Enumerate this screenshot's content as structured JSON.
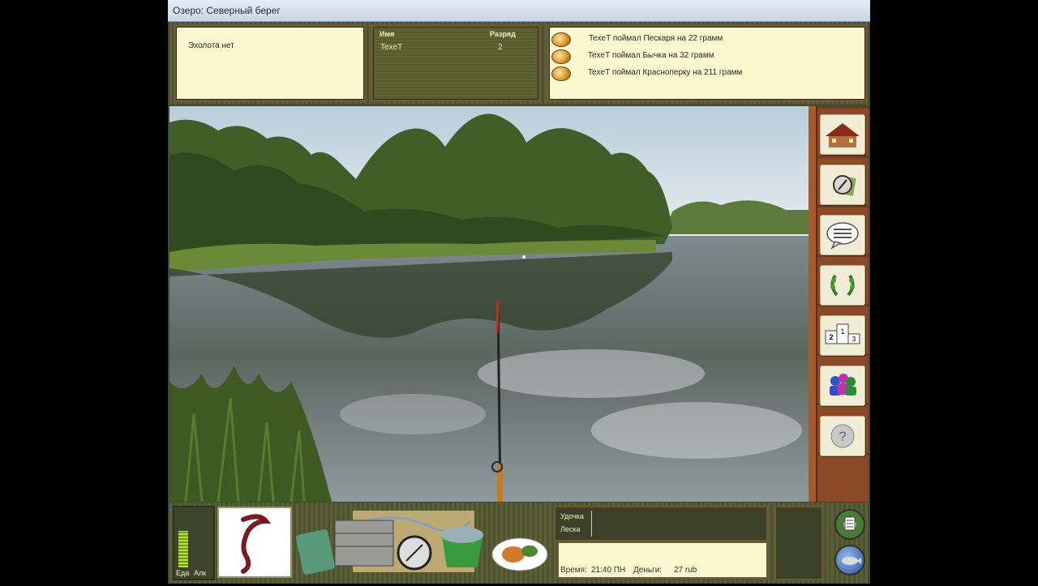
{
  "window": {
    "title": "Озеро: Северный берег"
  },
  "sonar": {
    "text": "Эхолота нет"
  },
  "players": {
    "col_name": "Имя",
    "col_rank": "Разряд",
    "rows": [
      {
        "name": "TexeT",
        "rank": "2"
      }
    ]
  },
  "log": {
    "entries": [
      "TexeT поймал Пескаря на 22 грамм",
      "TexeT поймал Бычка на 32 грамм",
      "TexeT поймал Красноперку на 211 грамм"
    ]
  },
  "menu": {
    "items": [
      "home-icon",
      "compass-icon",
      "chat-icon",
      "laurel-icon",
      "podium-icon",
      "people-icon",
      "help-icon"
    ],
    "podium": {
      "first": "1",
      "second": "2",
      "third": "3"
    },
    "help_glyph": "?"
  },
  "bottom": {
    "food_label": "Еда",
    "alc_label": "Алк",
    "food_level": 0.75,
    "alc_level": 0.0,
    "rod_label": "Удочка",
    "line_label": "Леска",
    "time_label": "Время:",
    "time_value": "21:40 ПН",
    "money_label": "Деньги:",
    "money_value": "27 rub"
  },
  "colors": {
    "panel_bg": "#fbf7cf",
    "frame": "#4e532f",
    "wood": "#8a4a2a",
    "meter": "#b6e53a"
  }
}
